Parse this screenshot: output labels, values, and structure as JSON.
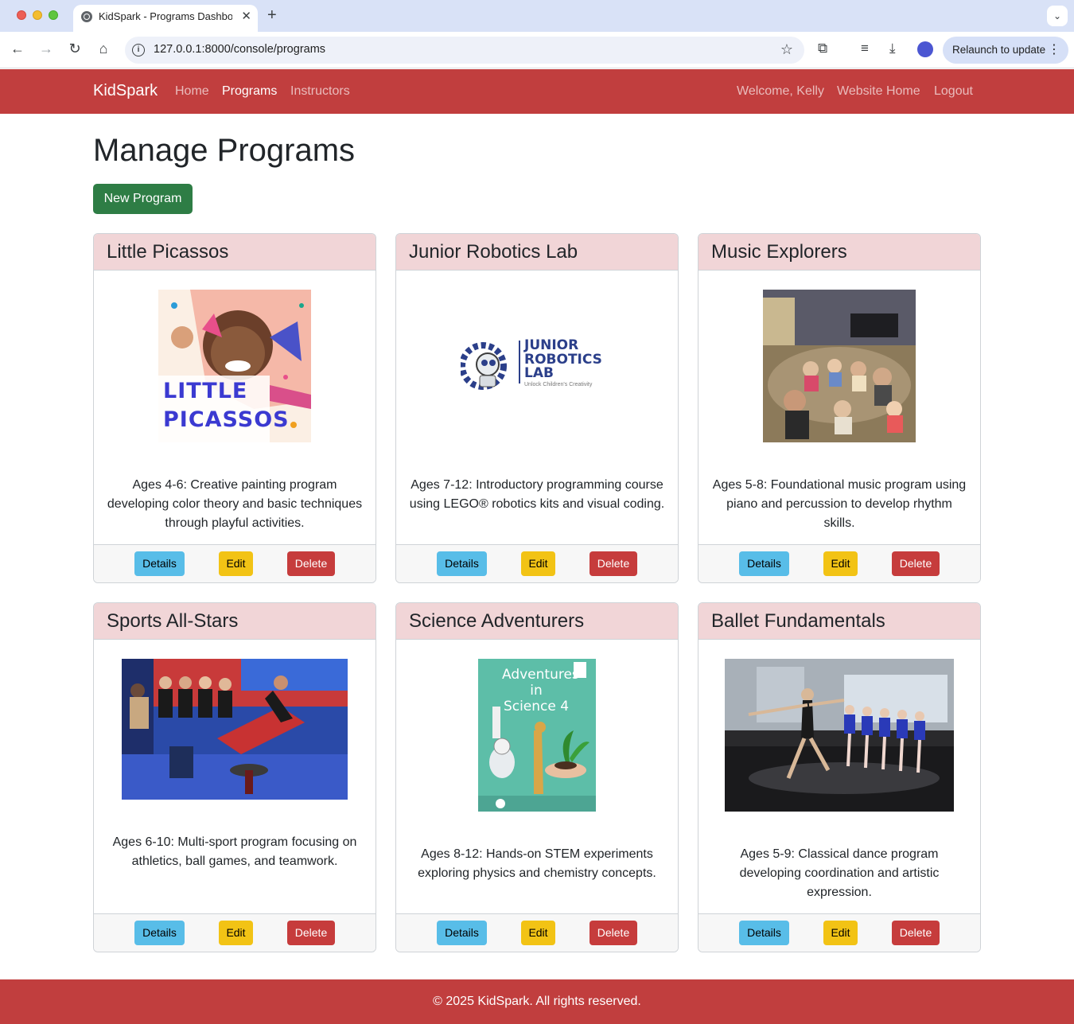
{
  "browser": {
    "tab_title": "KidSpark - Programs Dashboard",
    "url": "127.0.0.1:8000/console/programs",
    "relaunch_label": "Relaunch to update"
  },
  "navbar": {
    "brand": "KidSpark",
    "links": [
      "Home",
      "Programs",
      "Instructors"
    ],
    "active_link": "Programs",
    "right_links": [
      "Welcome, Kelly",
      "Website Home",
      "Logout"
    ],
    "color": "#c13e3e"
  },
  "main": {
    "title": "Manage Programs",
    "new_button": "New Program"
  },
  "programs": [
    {
      "name": "Little Picassos",
      "description": "Ages 4-6: Creative painting program developing color theory and basic techniques through playful activities.",
      "image_text": "LITTLE PICASSOS"
    },
    {
      "name": "Junior Robotics Lab",
      "description": "Ages 7-12: Introductory programming course using LEGO® robotics kits and visual coding.",
      "image_text": "JUNIOR ROBOTICS LAB",
      "image_subtext": "Unlock Children's Creativity"
    },
    {
      "name": "Music Explorers",
      "description": "Ages 5-8: Foundational music program using piano and percussion to develop rhythm skills."
    },
    {
      "name": "Sports All-Stars",
      "description": "Ages 6-10: Multi-sport program focusing on athletics, ball games, and teamwork."
    },
    {
      "name": "Science Adventurers",
      "description": "Ages 8-12: Hands-on STEM experiments exploring physics and chemistry concepts.",
      "image_text": "Adventures in Science 4"
    },
    {
      "name": "Ballet Fundamentals",
      "description": "Ages 5-9: Classical dance program developing coordination and artistic expression."
    }
  ],
  "card_buttons": {
    "details": "Details",
    "edit": "Edit",
    "delete": "Delete"
  },
  "footer": {
    "text": "© 2025 KidSpark. All rights reserved."
  }
}
